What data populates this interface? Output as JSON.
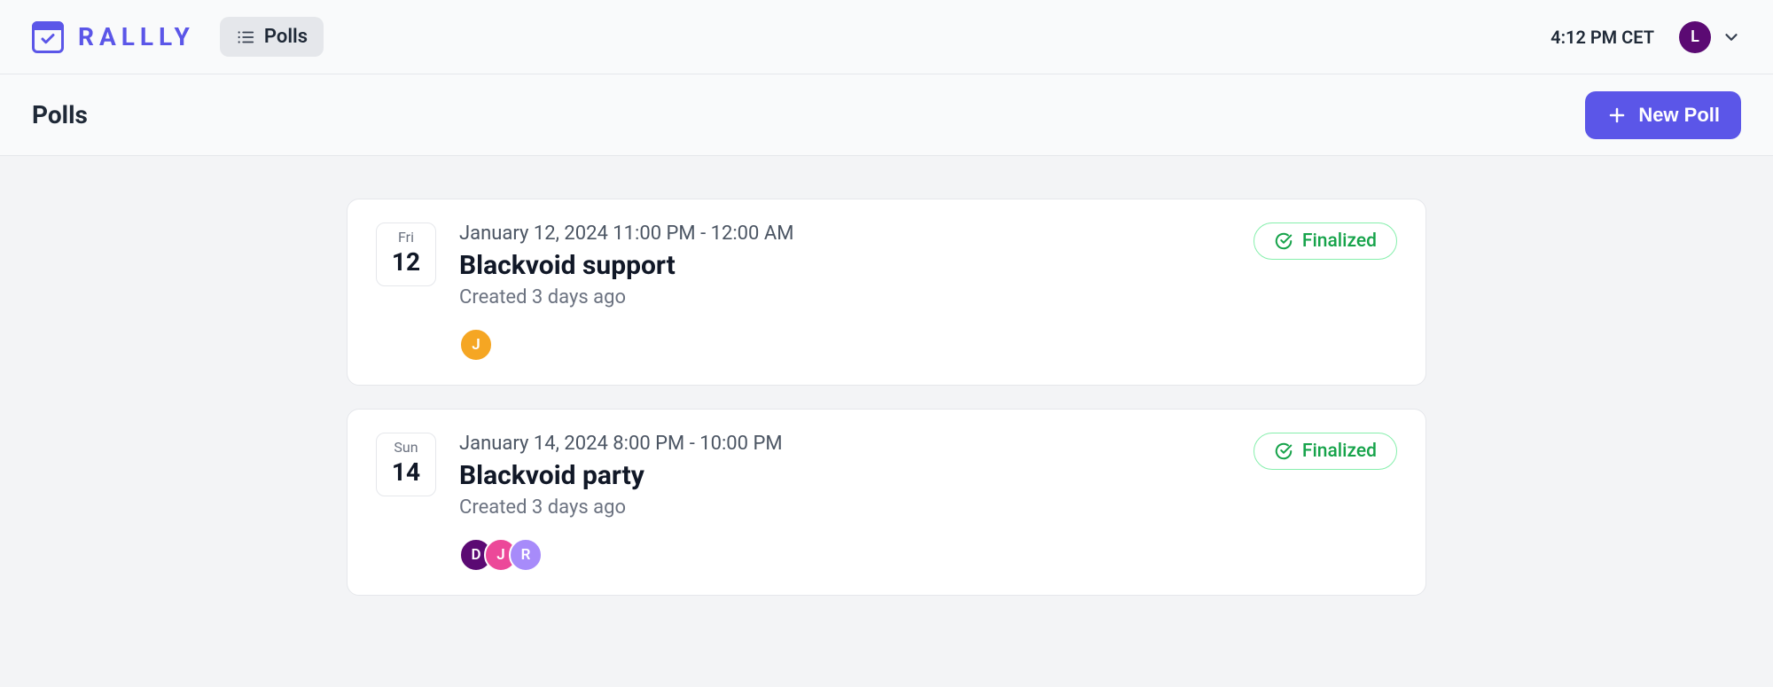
{
  "header": {
    "brand": "RALLLY",
    "nav_polls_label": "Polls",
    "clock": "4:12 PM CET",
    "user_initial": "L"
  },
  "sub_header": {
    "title": "Polls",
    "new_poll_label": "New Poll"
  },
  "polls": [
    {
      "dow": "Fri",
      "dom": "12",
      "datetime": "January 12, 2024 11:00 PM - 12:00 AM",
      "title": "Blackvoid support",
      "created": "Created 3 days ago",
      "status": "Finalized",
      "participants": [
        {
          "initial": "J",
          "color": "#f5a623"
        }
      ]
    },
    {
      "dow": "Sun",
      "dom": "14",
      "datetime": "January 14, 2024 8:00 PM - 10:00 PM",
      "title": "Blackvoid party",
      "created": "Created 3 days ago",
      "status": "Finalized",
      "participants": [
        {
          "initial": "D",
          "color": "#5b0a73"
        },
        {
          "initial": "J",
          "color": "#ec4899"
        },
        {
          "initial": "R",
          "color": "#a78bfa"
        }
      ]
    }
  ]
}
